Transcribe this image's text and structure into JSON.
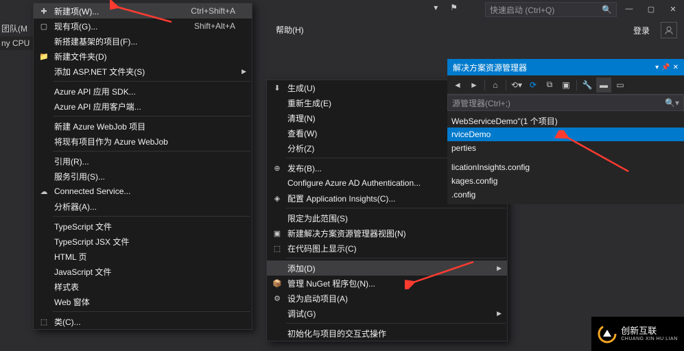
{
  "titlebar": {
    "quicklaunch_placeholder": "快速启动 (Ctrl+Q)"
  },
  "menubar": {
    "help": "帮助(H)",
    "login": "登录"
  },
  "left_tabs": {
    "t1": "团队(M",
    "t2": "ny CPU"
  },
  "menu_left": [
    {
      "type": "item",
      "icon": "new-item-icon",
      "label": "新建项(W)...",
      "shortcut": "Ctrl+Shift+A",
      "hl": true
    },
    {
      "type": "item",
      "icon": "existing-item-icon",
      "label": "现有项(G)...",
      "shortcut": "Shift+Alt+A"
    },
    {
      "type": "item",
      "icon": "",
      "label": "新搭建基架的项目(F)..."
    },
    {
      "type": "item",
      "icon": "new-folder-icon",
      "label": "新建文件夹(D)"
    },
    {
      "type": "item",
      "icon": "",
      "label": "添加 ASP.NET 文件夹(S)",
      "sub": true
    },
    {
      "type": "sep"
    },
    {
      "type": "item",
      "icon": "",
      "label": "Azure API 应用 SDK..."
    },
    {
      "type": "item",
      "icon": "",
      "label": "Azure API 应用客户端..."
    },
    {
      "type": "sep"
    },
    {
      "type": "item",
      "icon": "",
      "label": "新建 Azure WebJob 项目"
    },
    {
      "type": "item",
      "icon": "",
      "label": "将现有项目作为 Azure WebJob"
    },
    {
      "type": "sep"
    },
    {
      "type": "item",
      "icon": "",
      "label": "引用(R)..."
    },
    {
      "type": "item",
      "icon": "",
      "label": "服务引用(S)..."
    },
    {
      "type": "item",
      "icon": "connected-service-icon",
      "label": "Connected Service..."
    },
    {
      "type": "item",
      "icon": "",
      "label": "分析器(A)..."
    },
    {
      "type": "sep"
    },
    {
      "type": "item",
      "icon": "",
      "label": "TypeScript 文件"
    },
    {
      "type": "item",
      "icon": "",
      "label": "TypeScript JSX 文件"
    },
    {
      "type": "item",
      "icon": "",
      "label": "HTML 页"
    },
    {
      "type": "item",
      "icon": "",
      "label": "JavaScript 文件"
    },
    {
      "type": "item",
      "icon": "",
      "label": "样式表"
    },
    {
      "type": "item",
      "icon": "",
      "label": "Web 窗体"
    },
    {
      "type": "sep"
    },
    {
      "type": "item",
      "icon": "class-icon",
      "label": "类(C)..."
    }
  ],
  "menu_right": [
    {
      "type": "item",
      "icon": "build-icon",
      "label": "生成(U)"
    },
    {
      "type": "item",
      "icon": "",
      "label": "重新生成(E)"
    },
    {
      "type": "item",
      "icon": "",
      "label": "清理(N)"
    },
    {
      "type": "item",
      "icon": "",
      "label": "查看(W)",
      "sub": true
    },
    {
      "type": "item",
      "icon": "",
      "label": "分析(Z)",
      "sub": true
    },
    {
      "type": "sep"
    },
    {
      "type": "item",
      "icon": "publish-icon",
      "label": "发布(B)..."
    },
    {
      "type": "item",
      "icon": "",
      "label": "Configure Azure AD Authentication..."
    },
    {
      "type": "item",
      "icon": "appinsights-icon",
      "label": "配置 Application Insights(C)..."
    },
    {
      "type": "sep"
    },
    {
      "type": "item",
      "icon": "",
      "label": "限定为此范围(S)"
    },
    {
      "type": "item",
      "icon": "new-sol-explorer-icon",
      "label": "新建解决方案资源管理器视图(N)"
    },
    {
      "type": "item",
      "icon": "codemap-icon",
      "label": "在代码图上显示(C)"
    },
    {
      "type": "sep"
    },
    {
      "type": "item",
      "icon": "",
      "label": "添加(D)",
      "sub": true,
      "hl": true
    },
    {
      "type": "item",
      "icon": "nuget-icon",
      "label": "管理 NuGet 程序包(N)..."
    },
    {
      "type": "item",
      "icon": "startup-icon",
      "label": "设为启动项目(A)"
    },
    {
      "type": "item",
      "icon": "",
      "label": "调试(G)",
      "sub": true
    },
    {
      "type": "sep"
    },
    {
      "type": "item",
      "icon": "",
      "label": "初始化与项目的交互式操作"
    }
  ],
  "solution": {
    "title": "解决方案资源管理器",
    "search_placeholder": "源管理器(Ctrl+;)",
    "nodes": [
      {
        "label": "WebServiceDemo\"(1 个项目)",
        "sel": false,
        "ind": 0
      },
      {
        "label": "rviceDemo",
        "sel": true,
        "ind": 0
      },
      {
        "label": "perties",
        "sel": false,
        "ind": 0
      },
      {
        "label": "",
        "sel": false,
        "ind": 0,
        "blank": true
      },
      {
        "label": "licationInsights.config",
        "sel": false,
        "ind": 0
      },
      {
        "label": "kages.config",
        "sel": false,
        "ind": 0
      },
      {
        "label": ".config",
        "sel": false,
        "ind": 0
      }
    ]
  },
  "logo": {
    "brand": "创新互联",
    "sub": "CHUANG XIN HU LIAN"
  }
}
